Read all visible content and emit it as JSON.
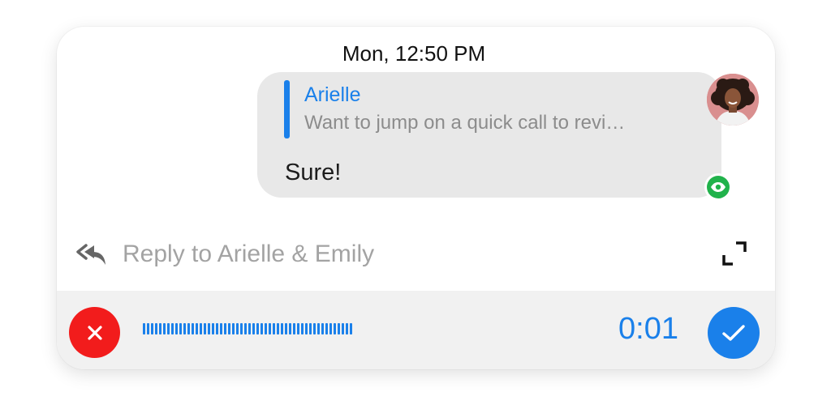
{
  "conversation": {
    "timestamp": "Mon, 12:50 PM"
  },
  "message": {
    "quote_author": "Arielle",
    "quote_text": "Want to jump on a quick call to revi…",
    "text": "Sure!",
    "avatar_icon": "user-avatar",
    "seen_icon": "eye-icon"
  },
  "composer": {
    "reply_icon": "reply-all-icon",
    "reply_placeholder": "Reply to Arielle & Emily",
    "expand_icon": "expand-icon"
  },
  "recording": {
    "cancel_icon": "close-icon",
    "duration": "0:01",
    "confirm_icon": "checkmark-icon"
  },
  "colors": {
    "accent_blue": "#1a80ea",
    "cancel_red": "#f21c1c",
    "seen_green": "#21b24b",
    "bubble_gray": "#e8e8e8",
    "recorder_gray": "#f1f1f1"
  }
}
